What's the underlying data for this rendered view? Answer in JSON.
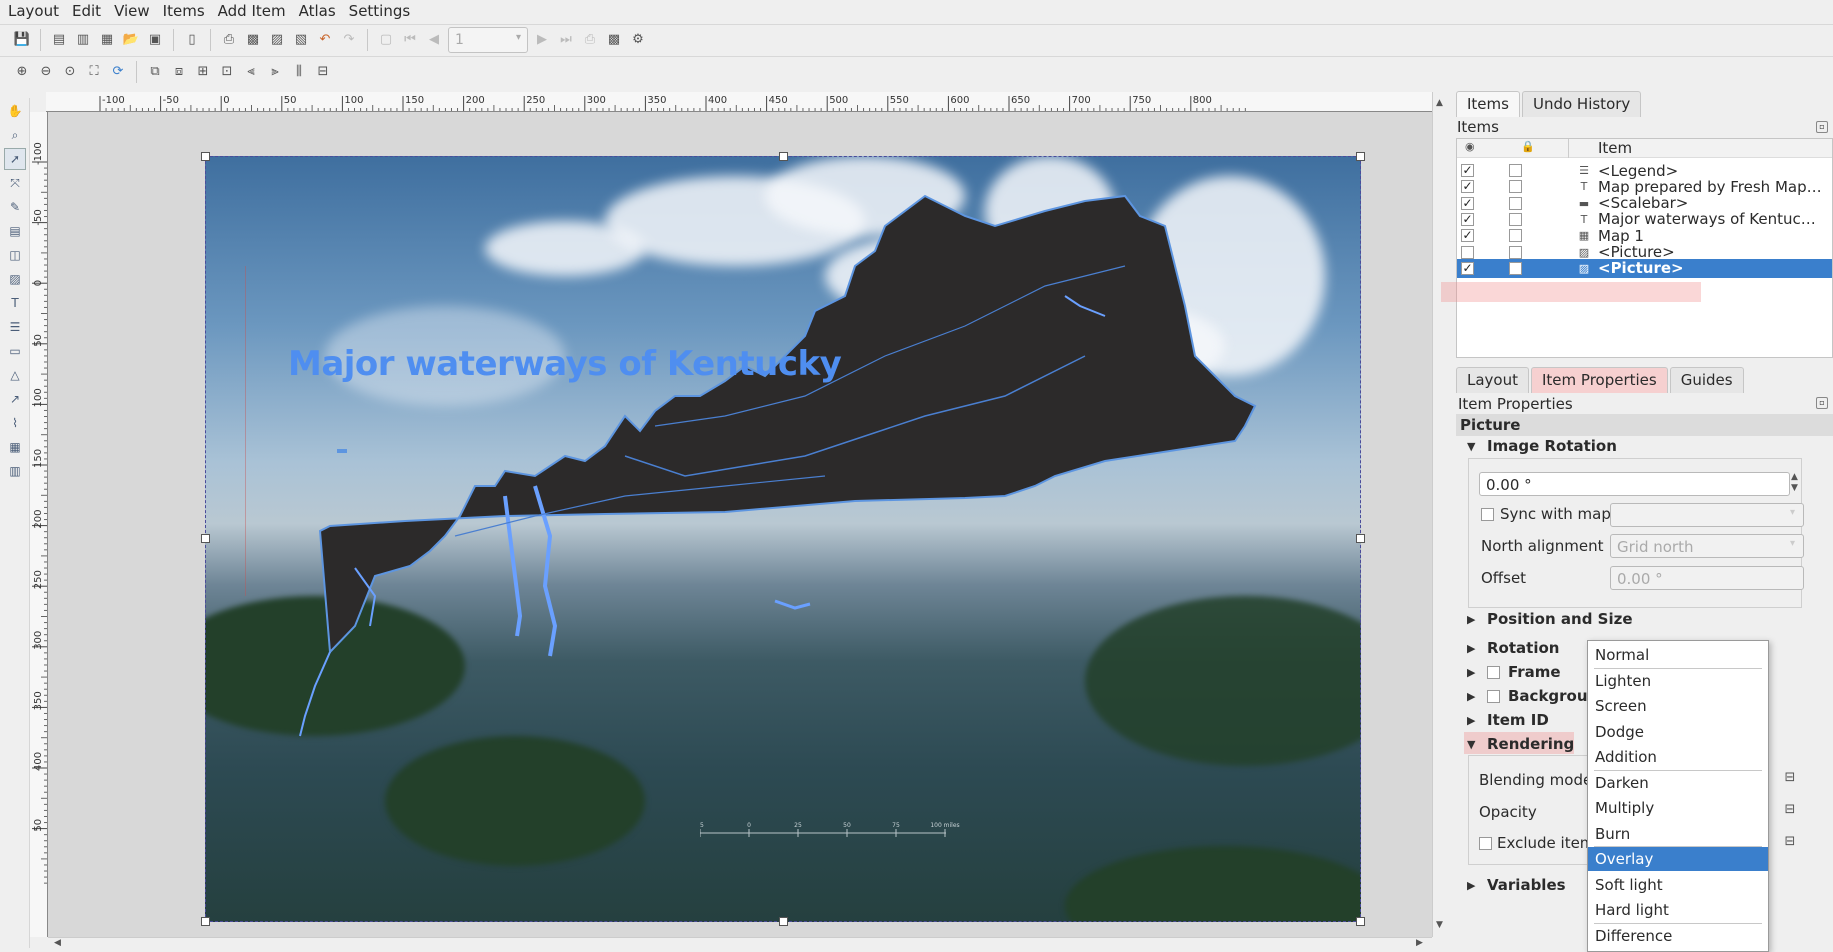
{
  "menu": [
    "Layout",
    "Edit",
    "View",
    "Items",
    "Add Item",
    "Atlas",
    "Settings"
  ],
  "toolbar": {
    "page_value": "1"
  },
  "ruler": {
    "h_ticks": [
      "-100",
      "-50",
      "0",
      "50",
      "100",
      "150",
      "200",
      "250",
      "300",
      "350",
      "400",
      "450",
      "500",
      "550",
      "600",
      "650",
      "700",
      "750",
      "800"
    ],
    "v_ticks": [
      "-100",
      "-50",
      "0",
      "50",
      "100",
      "150",
      "200",
      "250",
      "300",
      "350",
      "400",
      "50"
    ]
  },
  "map": {
    "title": "Major waterways of Kentucky",
    "scalebar_labels": [
      "25",
      "0",
      "25",
      "50",
      "75",
      "100 miles"
    ]
  },
  "panel": {
    "tabs_top": [
      "Items",
      "Undo History"
    ],
    "items_title": "Items",
    "column_item": "Item",
    "items": [
      {
        "label": "<Legend>",
        "visible": true,
        "icon": "legend-icon"
      },
      {
        "label": "Map prepared by Fresh Map…",
        "visible": true,
        "icon": "text-icon"
      },
      {
        "label": "<Scalebar>",
        "visible": true,
        "icon": "scalebar-icon"
      },
      {
        "label": "Major waterways of Kentuc…",
        "visible": true,
        "icon": "text-icon"
      },
      {
        "label": "Map 1",
        "visible": true,
        "icon": "map-icon"
      },
      {
        "label": "<Picture>",
        "visible": false,
        "icon": "picture-icon"
      },
      {
        "label": "<Picture>",
        "visible": true,
        "icon": "picture-icon",
        "selected": true
      }
    ],
    "tabs_bottom": [
      "Layout",
      "Item Properties",
      "Guides"
    ],
    "props_title": "Item Properties",
    "item_type": "Picture",
    "image_rotation": {
      "header": "Image Rotation",
      "value": "0.00 °",
      "sync_label": "Sync with map",
      "north_label": "North alignment",
      "north_value": "Grid north",
      "offset_label": "Offset",
      "offset_value": "0.00 °"
    },
    "sections": {
      "position_size": "Position and Size",
      "rotation": "Rotation",
      "frame": "Frame",
      "background": "Backgroun",
      "item_id": "Item ID",
      "rendering": "Rendering",
      "variables": "Variables"
    },
    "rendering": {
      "blending_label": "Blending mode",
      "opacity_label": "Opacity",
      "exclude_label": "Exclude item"
    }
  },
  "blend_dropdown": {
    "options": [
      "Normal",
      "Lighten",
      "Screen",
      "Dodge",
      "Addition",
      "Darken",
      "Multiply",
      "Burn",
      "Overlay",
      "Soft light",
      "Hard light",
      "Difference"
    ],
    "selected": "Overlay"
  }
}
